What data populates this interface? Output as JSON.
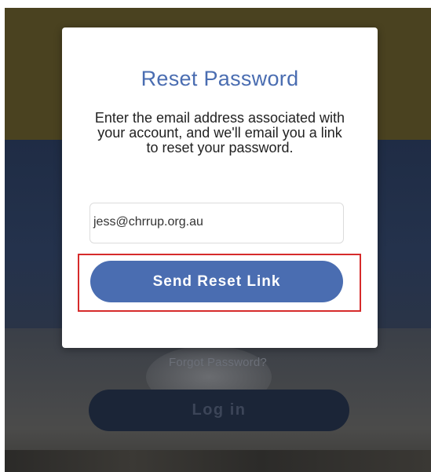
{
  "background": {
    "forgot_password_link": "Forgot Password?",
    "login_button_label": "Log in"
  },
  "modal": {
    "title": "Reset Password",
    "description": "Enter the email address associated with your account, and we'll email you a link to reset your password.",
    "email_value": "jess@chrrup.org.au",
    "send_button_label": "Send Reset Link"
  },
  "colors": {
    "accent": "#4a6db1",
    "highlight": "#d62b2b"
  }
}
